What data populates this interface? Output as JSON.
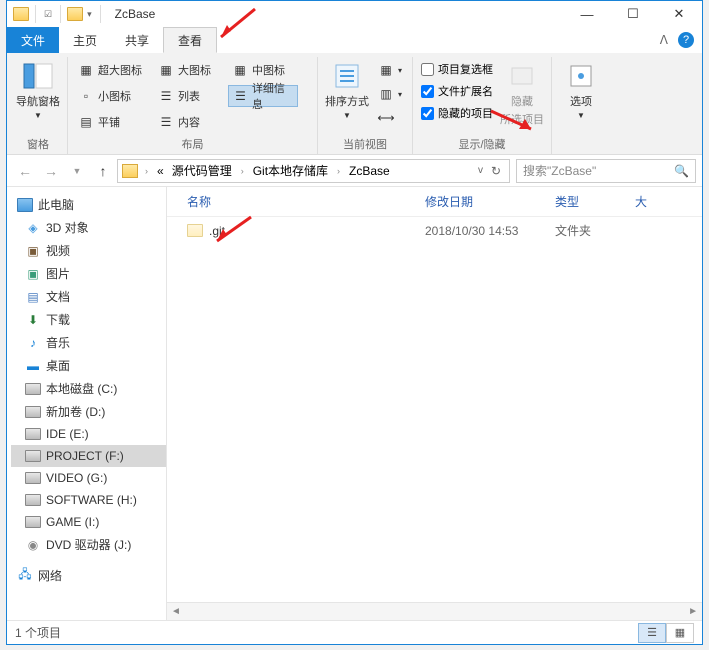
{
  "window_title": "ZcBase",
  "tabs": {
    "file": "文件",
    "home": "主页",
    "share": "共享",
    "view": "查看"
  },
  "ribbon": {
    "nav_pane": "导航窗格",
    "pane_group": "窗格",
    "large_icons": "超大图标",
    "big_icons": "大图标",
    "medium_icons": "中图标",
    "small_icons": "小图标",
    "list": "列表",
    "details": "详细信息",
    "tiles": "平铺",
    "content": "内容",
    "layout_group": "布局",
    "sort": "排序方式",
    "current_view": "当前视图",
    "item_checkboxes": "项目复选框",
    "file_ext": "文件扩展名",
    "hidden_items": "隐藏的项目",
    "hide_selected_top": "隐藏",
    "hide_selected_bottom": "所选项目",
    "options": "选项",
    "show_hide": "显示/隐藏"
  },
  "breadcrumb": {
    "prefix": "«",
    "p1": "源代码管理",
    "p2": "Git本地存储库",
    "p3": "ZcBase"
  },
  "search_placeholder": "搜索\"ZcBase\"",
  "columns": {
    "name": "名称",
    "modified": "修改日期",
    "type": "类型",
    "size": "大"
  },
  "files": [
    {
      "name": ".git",
      "modified": "2018/10/30 14:53",
      "type": "文件夹"
    }
  ],
  "tree": {
    "this_pc": "此电脑",
    "objects3d": "3D 对象",
    "videos": "视频",
    "pictures": "图片",
    "documents": "文档",
    "downloads": "下载",
    "music": "音乐",
    "desktop": "桌面",
    "drive_c": "本地磁盘 (C:)",
    "drive_d": "新加卷 (D:)",
    "drive_e": "IDE (E:)",
    "drive_f": "PROJECT (F:)",
    "drive_g": "VIDEO (G:)",
    "drive_h": "SOFTWARE (H:)",
    "drive_i": "GAME (I:)",
    "drive_j": "DVD 驱动器 (J:)",
    "network": "网络"
  },
  "status": "1 个项目"
}
